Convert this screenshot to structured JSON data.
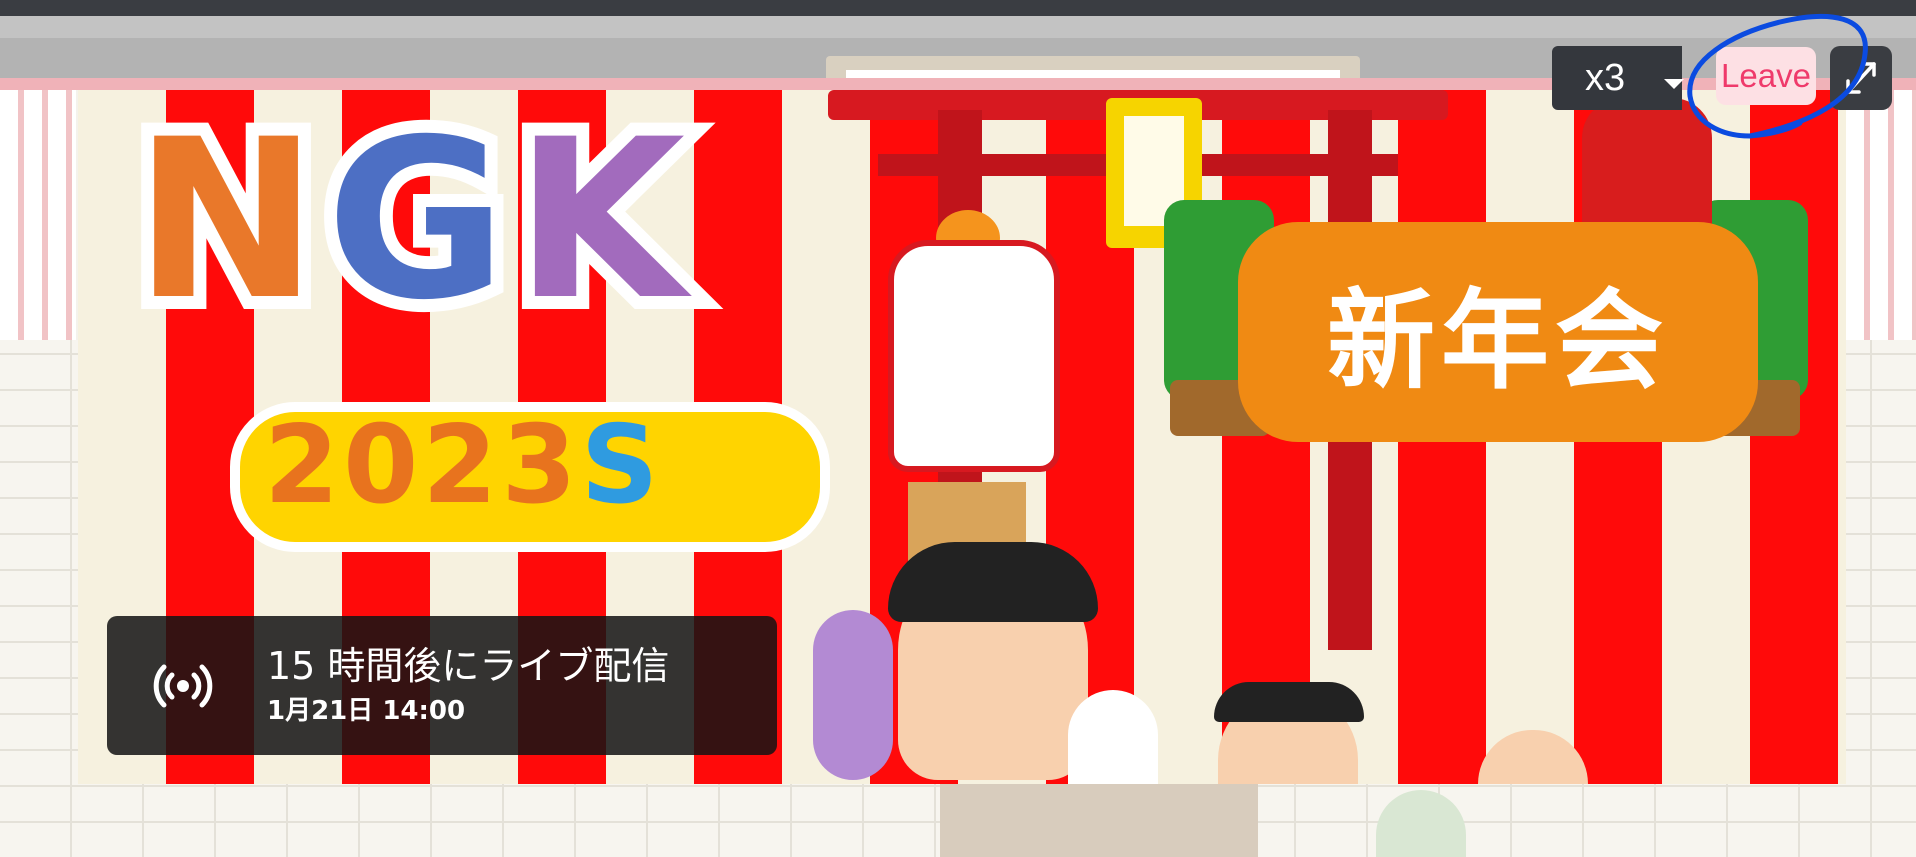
{
  "controls": {
    "speed": {
      "value": "x3"
    },
    "leave_label": "Leave",
    "fullscreen_icon": "expand-arrows-icon"
  },
  "stream": {
    "status": "15 時間後にライブ配信",
    "scheduled": "1月21日 14:00",
    "live_icon": "broadcast-icon"
  },
  "banner": {
    "logo_letters": [
      "N",
      "G",
      "K"
    ],
    "logo_year": "2023",
    "logo_suffix": "S",
    "sign_text": "新年会"
  },
  "colors": {
    "accent_leave": "#ef3a6b",
    "stage_red": "#ff0a0a",
    "stage_cream": "#f6f1df",
    "annotation_blue": "#0b4be0"
  }
}
